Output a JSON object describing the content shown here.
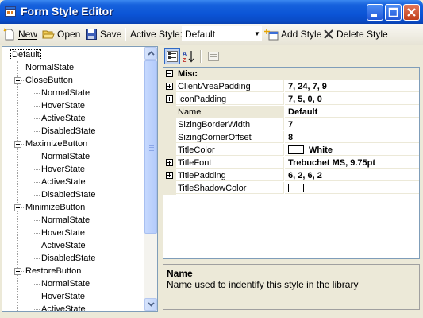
{
  "window": {
    "title": "Form Style Editor"
  },
  "toolbar": {
    "new_label": "New",
    "open_label": "Open",
    "save_label": "Save",
    "active_style_label": "Active Style:",
    "active_style_value": "Default",
    "add_style_label": "Add Style",
    "delete_style_label": "Delete Style"
  },
  "tree": {
    "nodes": [
      {
        "label": "Default",
        "level": 0,
        "selected": true
      },
      {
        "label": "NormalState",
        "level": 1
      },
      {
        "label": "CloseButton",
        "level": 1,
        "expandable": true
      },
      {
        "label": "NormalState",
        "level": 2
      },
      {
        "label": "HoverState",
        "level": 2
      },
      {
        "label": "ActiveState",
        "level": 2
      },
      {
        "label": "DisabledState",
        "level": 2
      },
      {
        "label": "MaximizeButton",
        "level": 1,
        "expandable": true
      },
      {
        "label": "NormalState",
        "level": 2
      },
      {
        "label": "HoverState",
        "level": 2
      },
      {
        "label": "ActiveState",
        "level": 2
      },
      {
        "label": "DisabledState",
        "level": 2
      },
      {
        "label": "MinimizeButton",
        "level": 1,
        "expandable": true
      },
      {
        "label": "NormalState",
        "level": 2
      },
      {
        "label": "HoverState",
        "level": 2
      },
      {
        "label": "ActiveState",
        "level": 2
      },
      {
        "label": "DisabledState",
        "level": 2
      },
      {
        "label": "RestoreButton",
        "level": 1,
        "expandable": true
      },
      {
        "label": "NormalState",
        "level": 2
      },
      {
        "label": "HoverState",
        "level": 2
      },
      {
        "label": "ActiveState",
        "level": 2
      }
    ]
  },
  "propgrid": {
    "category": "Misc",
    "rows": [
      {
        "name": "ClientAreaPadding",
        "value": "7, 24, 7, 9",
        "expandable": true
      },
      {
        "name": "IconPadding",
        "value": "7, 5, 0, 0",
        "expandable": true
      },
      {
        "name": "Name",
        "value": "Default",
        "selected": true
      },
      {
        "name": "SizingBorderWidth",
        "value": "7"
      },
      {
        "name": "SizingCornerOffset",
        "value": "8"
      },
      {
        "name": "TitleColor",
        "value": "White",
        "swatch": "#ffffff"
      },
      {
        "name": "TitleFont",
        "value": "Trebuchet MS, 9.75pt",
        "expandable": true
      },
      {
        "name": "TitlePadding",
        "value": "6, 2, 6, 2",
        "expandable": true
      },
      {
        "name": "TitleShadowColor",
        "value": "",
        "swatch": "#ffffff"
      }
    ],
    "description_title": "Name",
    "description_text": "Name used to indentify this style in the library"
  },
  "colors": {
    "titlebar": "#0b54d6",
    "window_bg": "#ece9d8",
    "border": "#7f9db9"
  }
}
